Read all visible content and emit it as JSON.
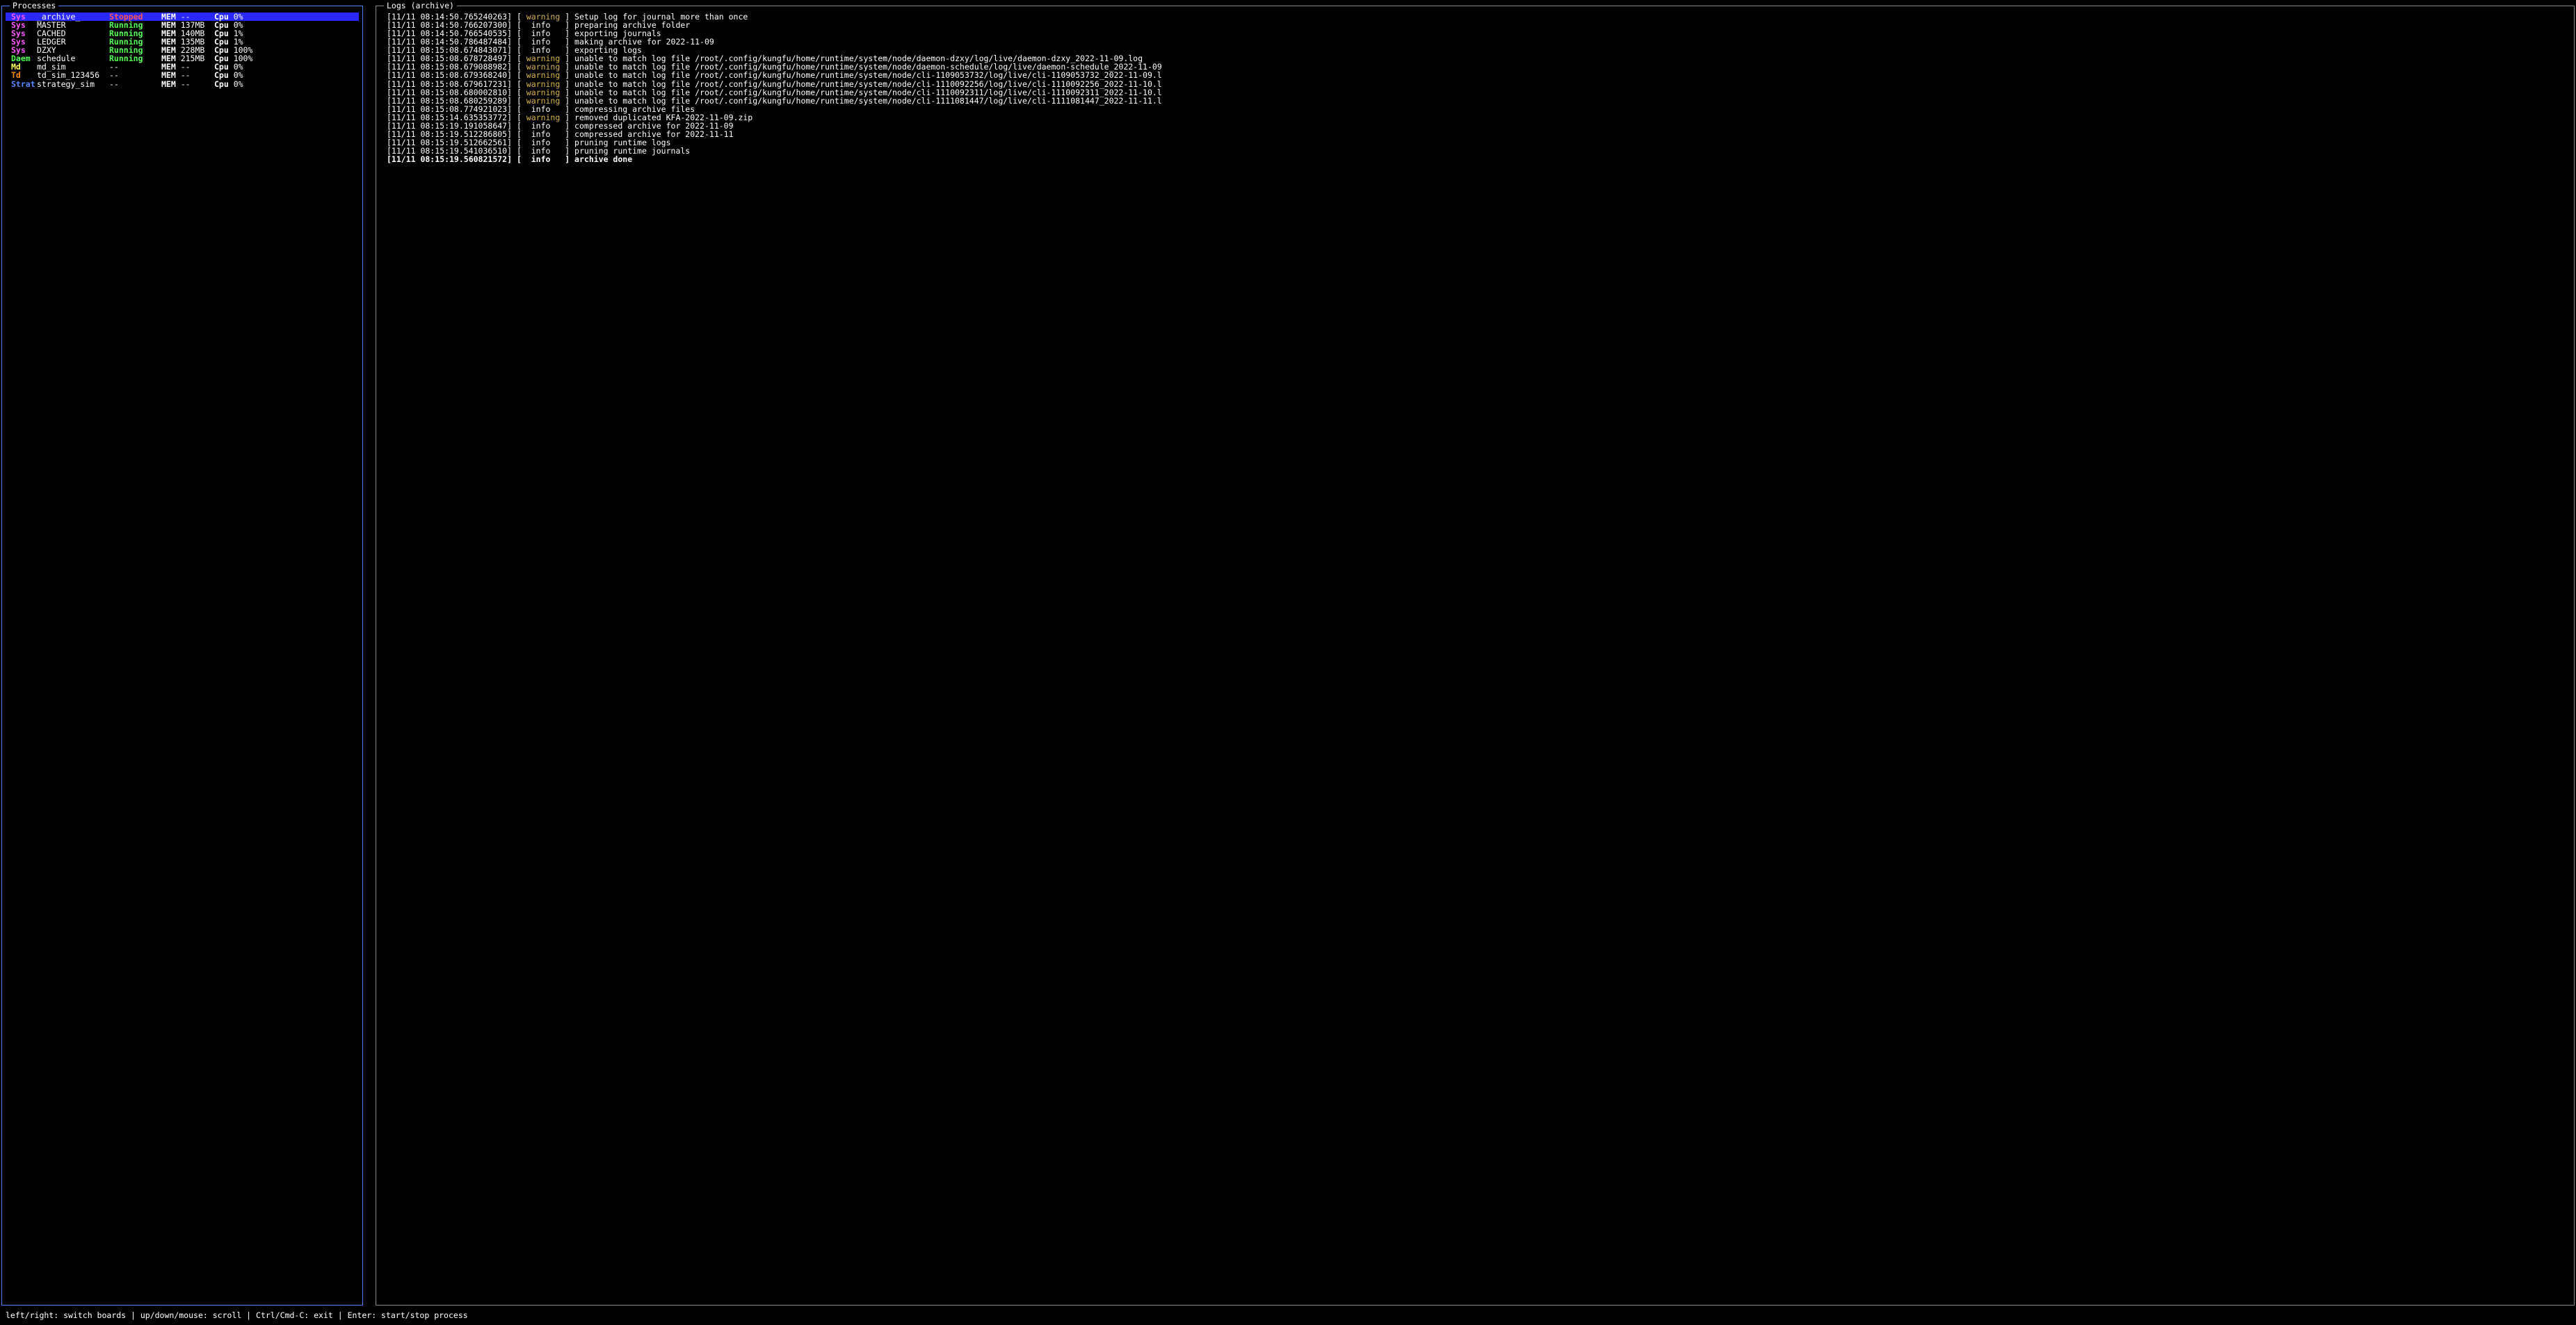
{
  "panels": {
    "left_title": "Processes",
    "right_title": "Logs (archive)"
  },
  "processes": [
    {
      "cat": "Sys",
      "cat_class": "cat-sys",
      "name": "_archive_",
      "status": "Stopped",
      "status_class": "status-stopped",
      "mem_label": "MEM",
      "mem_val": "--",
      "cpu_label": "Cpu",
      "cpu_val": "0%",
      "selected": true
    },
    {
      "cat": "Sys",
      "cat_class": "cat-sys",
      "name": "MASTER",
      "status": "Running",
      "status_class": "status-running",
      "mem_label": "MEM",
      "mem_val": "137MB",
      "cpu_label": "Cpu",
      "cpu_val": "0%",
      "selected": false
    },
    {
      "cat": "Sys",
      "cat_class": "cat-sys",
      "name": "CACHED",
      "status": "Running",
      "status_class": "status-running",
      "mem_label": "MEM",
      "mem_val": "140MB",
      "cpu_label": "Cpu",
      "cpu_val": "1%",
      "selected": false
    },
    {
      "cat": "Sys",
      "cat_class": "cat-sys",
      "name": "LEDGER",
      "status": "Running",
      "status_class": "status-running",
      "mem_label": "MEM",
      "mem_val": "135MB",
      "cpu_label": "Cpu",
      "cpu_val": "1%",
      "selected": false
    },
    {
      "cat": "Sys",
      "cat_class": "cat-sys",
      "name": "DZXY",
      "status": "Running",
      "status_class": "status-running",
      "mem_label": "MEM",
      "mem_val": "228MB",
      "cpu_label": "Cpu",
      "cpu_val": "100%",
      "selected": false
    },
    {
      "cat": "Daem",
      "cat_class": "cat-daem",
      "name": "schedule",
      "status": "Running",
      "status_class": "status-running",
      "mem_label": "MEM",
      "mem_val": "215MB",
      "cpu_label": "Cpu",
      "cpu_val": "100%",
      "selected": false
    },
    {
      "cat": "Md",
      "cat_class": "cat-md",
      "name": "md_sim",
      "status": "--",
      "status_class": "status-none",
      "mem_label": "MEM",
      "mem_val": "--",
      "cpu_label": "Cpu",
      "cpu_val": "0%",
      "selected": false
    },
    {
      "cat": "Td",
      "cat_class": "cat-td",
      "name": "td_sim_123456",
      "status": "--",
      "status_class": "status-none",
      "mem_label": "MEM",
      "mem_val": "--",
      "cpu_label": "Cpu",
      "cpu_val": "0%",
      "selected": false
    },
    {
      "cat": "Strat",
      "cat_class": "cat-strat",
      "name": "strategy_sim",
      "status": "--",
      "status_class": "status-none",
      "mem_label": "MEM",
      "mem_val": "--",
      "cpu_label": "Cpu",
      "cpu_val": "0%",
      "selected": false
    }
  ],
  "logs": [
    {
      "ts": "[11/11 08:14:50.765240263]",
      "level": "warning",
      "msg": "Setup log for journal more than once",
      "bold": false
    },
    {
      "ts": "[11/11 08:14:50.766207300]",
      "level": "info",
      "msg": "preparing archive folder",
      "bold": false
    },
    {
      "ts": "[11/11 08:14:50.766540535]",
      "level": "info",
      "msg": "exporting journals",
      "bold": false
    },
    {
      "ts": "[11/11 08:14:50.786487484]",
      "level": "info",
      "msg": "making archive for 2022-11-09",
      "bold": false
    },
    {
      "ts": "[11/11 08:15:08.674843071]",
      "level": "info",
      "msg": "exporting logs",
      "bold": false
    },
    {
      "ts": "[11/11 08:15:08.678728497]",
      "level": "warning",
      "msg": "unable to match log file /root/.config/kungfu/home/runtime/system/node/daemon-dzxy/log/live/daemon-dzxy_2022-11-09.log",
      "bold": false
    },
    {
      "ts": "[11/11 08:15:08.679088982]",
      "level": "warning",
      "msg": "unable to match log file /root/.config/kungfu/home/runtime/system/node/daemon-schedule/log/live/daemon-schedule_2022-11-09",
      "bold": false
    },
    {
      "ts": "[11/11 08:15:08.679368240]",
      "level": "warning",
      "msg": "unable to match log file /root/.config/kungfu/home/runtime/system/node/cli-1109053732/log/live/cli-1109053732_2022-11-09.l",
      "bold": false
    },
    {
      "ts": "[11/11 08:15:08.679617231]",
      "level": "warning",
      "msg": "unable to match log file /root/.config/kungfu/home/runtime/system/node/cli-1110092256/log/live/cli-1110092256_2022-11-10.l",
      "bold": false
    },
    {
      "ts": "[11/11 08:15:08.680002810]",
      "level": "warning",
      "msg": "unable to match log file /root/.config/kungfu/home/runtime/system/node/cli-1110092311/log/live/cli-1110092311_2022-11-10.l",
      "bold": false
    },
    {
      "ts": "[11/11 08:15:08.680259289]",
      "level": "warning",
      "msg": "unable to match log file /root/.config/kungfu/home/runtime/system/node/cli-1111081447/log/live/cli-1111081447_2022-11-11.l",
      "bold": false
    },
    {
      "ts": "[11/11 08:15:08.774921023]",
      "level": "info",
      "msg": "compressing archive files",
      "bold": false
    },
    {
      "ts": "[11/11 08:15:14.635353772]",
      "level": "warning",
      "msg": "removed duplicated KFA-2022-11-09.zip",
      "bold": false
    },
    {
      "ts": "[11/11 08:15:19.191058647]",
      "level": "info",
      "msg": "compressed archive for 2022-11-09",
      "bold": false
    },
    {
      "ts": "[11/11 08:15:19.512286805]",
      "level": "info",
      "msg": "compressed archive for 2022-11-11",
      "bold": false
    },
    {
      "ts": "[11/11 08:15:19.512662561]",
      "level": "info",
      "msg": "pruning runtime logs",
      "bold": false
    },
    {
      "ts": "[11/11 08:15:19.541036510]",
      "level": "info",
      "msg": "pruning runtime journals",
      "bold": false
    },
    {
      "ts": "[11/11 08:15:19.560821572]",
      "level": "info",
      "msg": "archive done",
      "bold": true
    }
  ],
  "footer": "left/right: switch boards | up/down/mouse: scroll | Ctrl/Cmd-C: exit | Enter: start/stop process"
}
